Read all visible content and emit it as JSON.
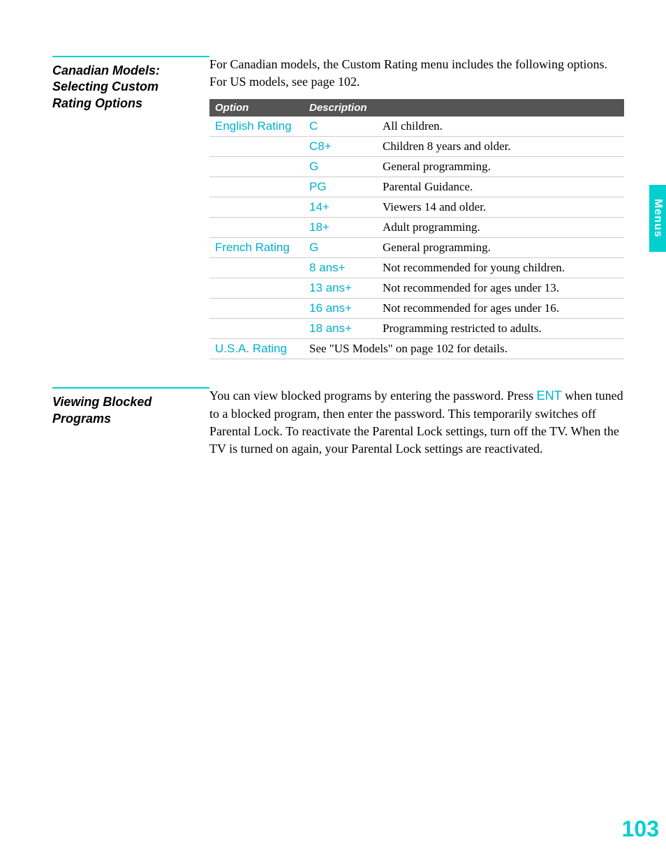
{
  "side_tab": "Menus",
  "page_number": "103",
  "sections": [
    {
      "title": "Canadian Models: Selecting Custom Rating Options",
      "intro_before_page": "For Canadian models, the Custom Rating menu includes the following options. For US models, see page 102",
      "intro_after": ".",
      "table": {
        "headers": [
          "Option",
          "Description"
        ],
        "rows": [
          {
            "option": "English Rating",
            "code": "C",
            "desc": "All children."
          },
          {
            "option": "",
            "code": "C8+",
            "desc": "Children 8 years and older."
          },
          {
            "option": "",
            "code": "G",
            "desc": "General programming."
          },
          {
            "option": "",
            "code": "PG",
            "desc": "Parental Guidance."
          },
          {
            "option": "",
            "code": "14+",
            "desc": "Viewers 14 and older."
          },
          {
            "option": "",
            "code": "18+",
            "desc": "Adult programming."
          },
          {
            "option": "French Rating",
            "code": "G",
            "desc": "General programming."
          },
          {
            "option": "",
            "code": "8 ans+",
            "desc": "Not recommended for young children."
          },
          {
            "option": "",
            "code": "13 ans+",
            "desc": "Not recommended for ages under 13."
          },
          {
            "option": "",
            "code": "16 ans+",
            "desc": "Not recommended for ages under 16."
          },
          {
            "option": "",
            "code": "18 ans+",
            "desc": "Programming restricted to adults."
          },
          {
            "option": "U.S.A. Rating",
            "code": "",
            "desc": "See \"US Models\" on page 102 for details.",
            "span": true
          }
        ]
      }
    },
    {
      "title": "Viewing Blocked Programs",
      "body": {
        "part1": "You can view blocked programs by entering the password. Press ",
        "ent": "ENT",
        "part2": " when tuned to a blocked program, then enter the password. This temporarily switches off Parental Lock. To reactivate the Parental Lock settings, turn off the TV. When the TV is turned on again, your Parental Lock settings are reactivated."
      }
    }
  ]
}
